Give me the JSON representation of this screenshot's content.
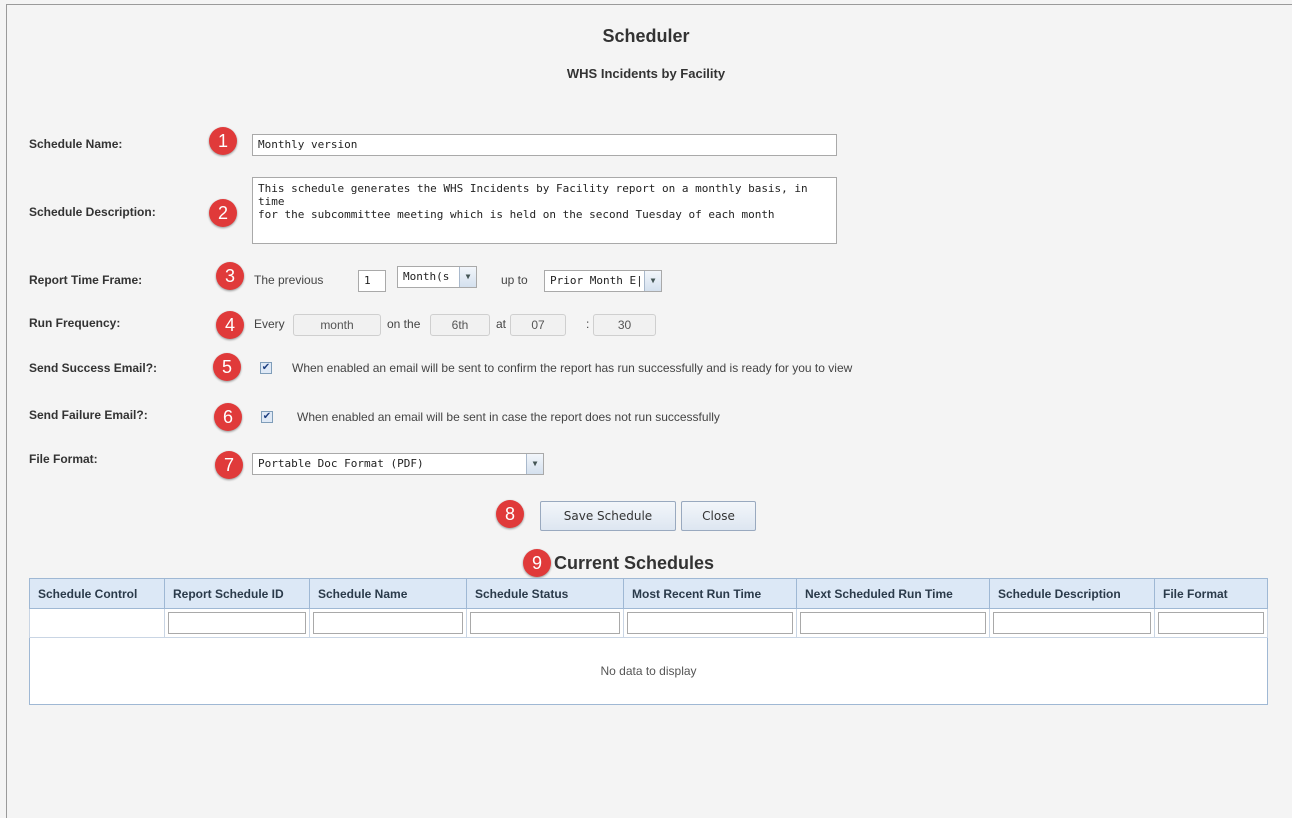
{
  "header": {
    "title": "Scheduler",
    "subtitle": "WHS Incidents by Facility"
  },
  "badges": [
    "1",
    "2",
    "3",
    "4",
    "5",
    "6",
    "7",
    "8",
    "9"
  ],
  "form": {
    "schedule_name": {
      "label": "Schedule Name:",
      "value": "Monthly version"
    },
    "schedule_description": {
      "label": "Schedule Description:",
      "line1": "This schedule generates the WHS Incidents by Facility report on a monthly basis, in time",
      "line2": "for the subcommittee meeting which is held on the second Tuesday of each month"
    },
    "report_time_frame": {
      "label": "Report Time Frame:",
      "prefix": "The previous",
      "count": "1",
      "unit": "Month(s",
      "up_to_label": "up to",
      "up_to_value": "Prior Month E|"
    },
    "run_frequency": {
      "label": "Run Frequency:",
      "every_label": "Every",
      "every_value": "month",
      "on_the_label": "on the",
      "day_value": "6th",
      "at_label": "at",
      "hour_value": "07",
      "colon": ":",
      "minute_value": "30"
    },
    "send_success_email": {
      "label": "Send Success Email?:",
      "checked": true,
      "help": "When enabled an email will be sent to confirm the report has run successfully and is ready for you to view"
    },
    "send_failure_email": {
      "label": "Send Failure Email?:",
      "checked": true,
      "help": "When enabled an email will be sent in case the report does not run successfully"
    },
    "file_format": {
      "label": "File Format:",
      "value": "Portable Doc Format (PDF)"
    }
  },
  "buttons": {
    "save": "Save Schedule",
    "close": "Close"
  },
  "schedules": {
    "title": "Current Schedules",
    "columns": [
      "Schedule Control",
      "Report Schedule ID",
      "Schedule Name",
      "Schedule Status",
      "Most Recent Run Time",
      "Next Scheduled Run Time",
      "Schedule Description",
      "File Format"
    ],
    "empty_text": "No data to display"
  },
  "icons": {
    "dropdown": "chevron-down-icon",
    "checkbox_mark": "check-icon"
  },
  "colors": {
    "badge": "#e03a3a",
    "header_bg": "#dce8f6",
    "page_bg": "#f4f4f4"
  }
}
